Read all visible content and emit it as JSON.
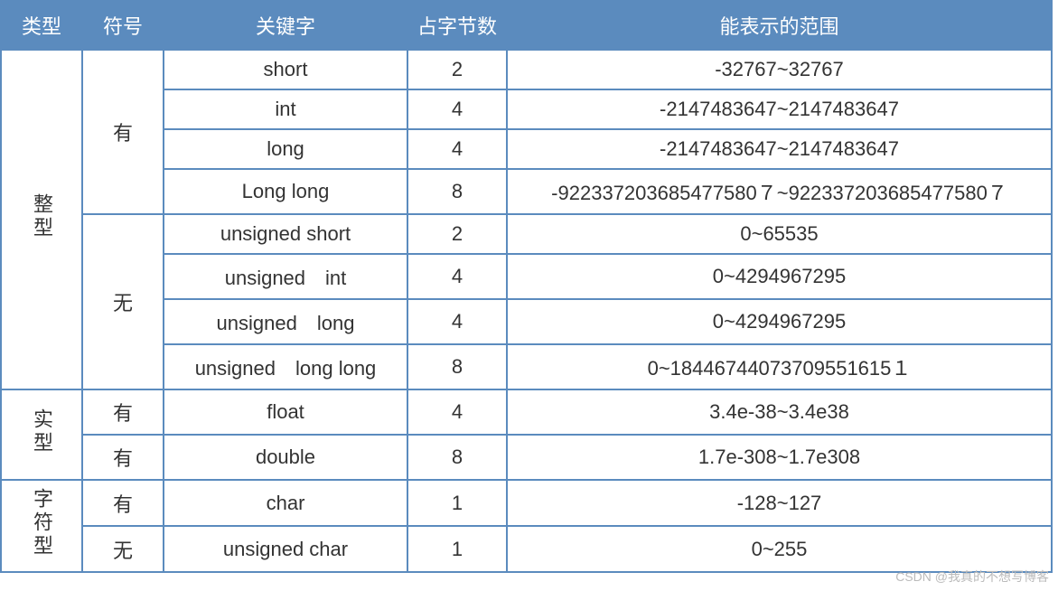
{
  "headers": {
    "type": "类型",
    "sign": "符号",
    "keyword": "关键字",
    "bytes": "占字节数",
    "range": "能表示的范围"
  },
  "types": {
    "integer": "整型",
    "real": "实型",
    "char": "字符型"
  },
  "signs": {
    "yes": "有",
    "no": "无"
  },
  "rows": {
    "r0": {
      "keyword": "short",
      "bytes": "2",
      "range": "-32767~32767"
    },
    "r1": {
      "keyword": "int",
      "bytes": "4",
      "range": "-2147483647~2147483647"
    },
    "r2": {
      "keyword": "long",
      "bytes": "4",
      "range": "-2147483647~2147483647"
    },
    "r3": {
      "keyword": "Long long",
      "bytes": "8",
      "range": "-922337203685477580７~922337203685477580７"
    },
    "r4": {
      "keyword": "unsigned short",
      "bytes": "2",
      "range": "0~65535"
    },
    "r5": {
      "keyword": "unsigned　int",
      "bytes": "4",
      "range": "0~4294967295"
    },
    "r6": {
      "keyword": "unsigned　long",
      "bytes": "4",
      "range": "0~4294967295"
    },
    "r7": {
      "keyword": "unsigned　long long",
      "bytes": "8",
      "range": "0~18446744073709551615１"
    },
    "r8": {
      "keyword": "float",
      "bytes": "4",
      "range": "3.4e-38~3.4e38"
    },
    "r9": {
      "keyword": "double",
      "bytes": "8",
      "range": "1.7e-308~1.7e308"
    },
    "r10": {
      "keyword": "char",
      "bytes": "1",
      "range": "-128~127"
    },
    "r11": {
      "keyword": "unsigned char",
      "bytes": "1",
      "range": "0~255"
    }
  },
  "watermark": "CSDN @我真的不想写博客"
}
